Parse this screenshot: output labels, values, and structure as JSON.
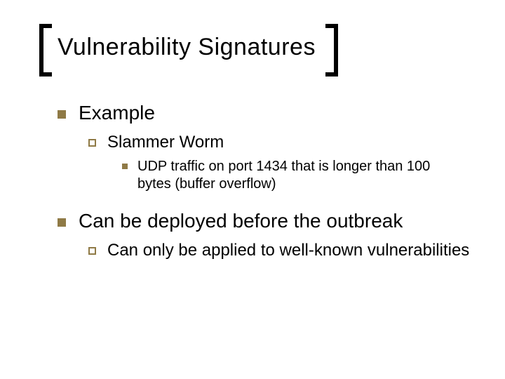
{
  "title": "Vulnerability Signatures",
  "items": [
    {
      "label": "Example",
      "children": [
        {
          "label": "Slammer Worm",
          "children": [
            {
              "label": "UDP traffic on port 1434 that is longer than 100 bytes (buffer overflow)"
            }
          ]
        }
      ]
    },
    {
      "label": "Can be deployed before the outbreak",
      "children": [
        {
          "label": "Can only be applied to well-known vulnerabilities"
        }
      ]
    }
  ],
  "colors": {
    "bullet": "#8f7a46"
  }
}
